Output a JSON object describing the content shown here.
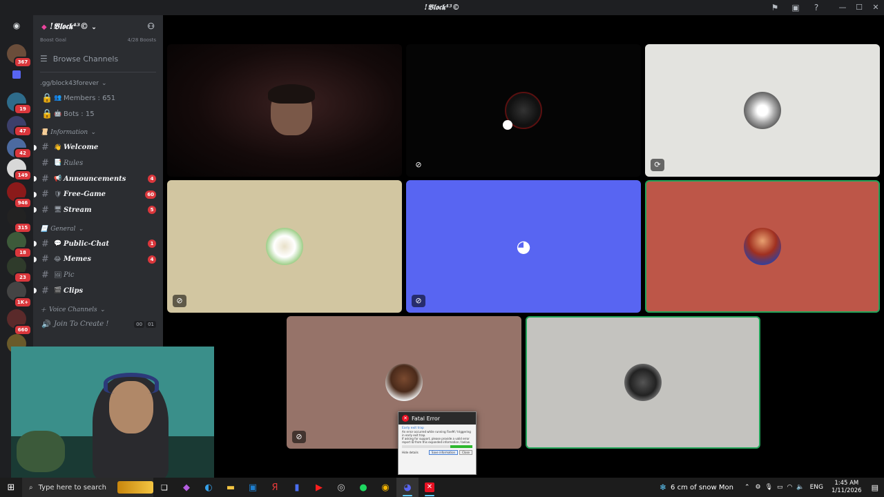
{
  "window": {
    "title": "!𝕭𝖑𝖔𝖈𝖐⁴³©"
  },
  "sidebar": {
    "guild_name": "!𝕭𝖑𝖔𝖈𝖐⁴³©",
    "boost_goal_label": "Boost Goal",
    "boost_goal_count": "4/28 Boosts",
    "browse_label": "Browse Channels",
    "invite_label": ".gg/block43forever",
    "stats": [
      {
        "label": "Members : 651"
      },
      {
        "label": "Bots : 15"
      }
    ],
    "categories": [
      {
        "name": "Information",
        "channels": [
          {
            "emoji": "👋",
            "name": "Welcome",
            "badge": "",
            "bold": true
          },
          {
            "emoji": "📑",
            "name": "Rules",
            "badge": "",
            "bold": false
          },
          {
            "emoji": "📢",
            "name": "Announcements",
            "badge": "4",
            "bold": true
          },
          {
            "emoji": "🛡",
            "name": "Free-Game",
            "badge": "60",
            "bold": true
          },
          {
            "emoji": "🖥",
            "name": "Stream",
            "badge": "5",
            "bold": true
          }
        ]
      },
      {
        "name": "General",
        "channels": [
          {
            "emoji": "💬",
            "name": "Public-Chat",
            "badge": "1",
            "bold": true
          },
          {
            "emoji": "😂",
            "name": "Memes",
            "badge": "4",
            "bold": true
          },
          {
            "emoji": "🖼",
            "name": "Pic",
            "badge": "",
            "bold": false
          },
          {
            "emoji": "🎬",
            "name": "Clips",
            "badge": "",
            "bold": true
          }
        ]
      }
    ],
    "voice_category": "Voice Channels",
    "voice_channel": {
      "name": "Join To Create !",
      "count_a": "00",
      "count_b": "01"
    }
  },
  "servers": {
    "badges": [
      "367",
      "19",
      "47",
      "42",
      "149",
      "946",
      "315",
      "18",
      "23",
      "1K+",
      "660"
    ]
  },
  "fatal_dialog": {
    "title": "Fatal Error",
    "subtitle": "Early exit trap",
    "line1": "An error occurred while running FiveM / triggering in early exit trap.",
    "line2": "If asking for support, please provide a valid error report ID from this expanded information / below.",
    "save_button": "Save information",
    "close_button": "Close",
    "hide_details": "Hide details"
  },
  "taskbar": {
    "search_placeholder": "Type here to search",
    "weather": "6 cm of snow Mon",
    "language": "ENG",
    "time": "1:45 AM",
    "date": "1/11/2026"
  },
  "colors": {
    "discord_blurple": "#5865f2",
    "tile_beige": "#d2c6a1",
    "tile_red": "#bd5648",
    "tile_brown": "#967369",
    "tile_grey": "#c4c3bf",
    "tile_offwhite": "#e3e3df"
  }
}
